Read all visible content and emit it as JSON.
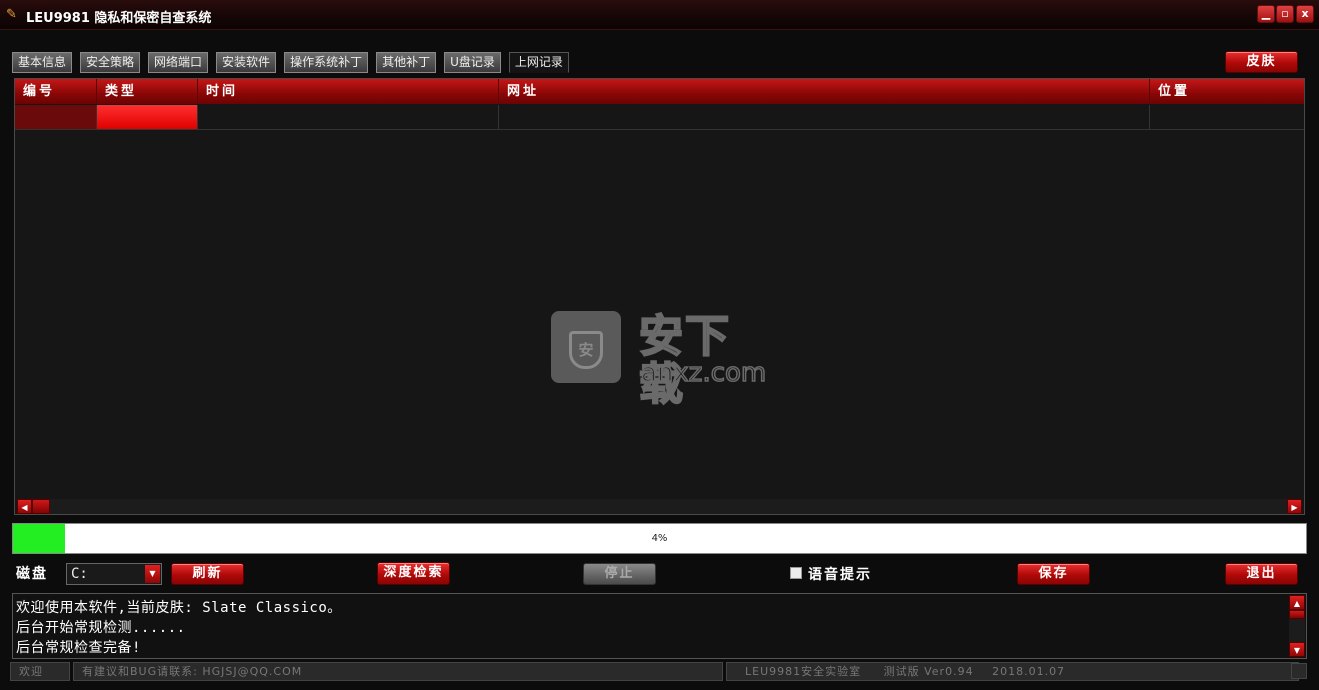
{
  "window": {
    "title": "LEU9981 隐私和保密自查系统",
    "minimize": "▁",
    "maximize": "▫",
    "close": "x"
  },
  "tabs": [
    {
      "label": "基本信息"
    },
    {
      "label": "安全策略"
    },
    {
      "label": "网络端口"
    },
    {
      "label": "安装软件"
    },
    {
      "label": "操作系统补丁"
    },
    {
      "label": "其他补丁"
    },
    {
      "label": "U盘记录"
    },
    {
      "label": "上网记录",
      "active": true
    }
  ],
  "skin_button": "皮肤",
  "table": {
    "columns": [
      "编号",
      "类型",
      "时间",
      "网址",
      "位置"
    ],
    "rows": [
      [
        "",
        "",
        "",
        "",
        ""
      ]
    ]
  },
  "watermark": {
    "cn": "安下载",
    "en": "anxz.com",
    "shield": "安"
  },
  "progress": {
    "value": 0.04,
    "label": "4%",
    "color": "#22ee22"
  },
  "controls": {
    "disk_label": "磁盘",
    "disk_value": "C:",
    "refresh": "刷新",
    "deep_search": "深度检索",
    "stop": "停止",
    "voice_hint": "语音提示",
    "save": "保存",
    "exit": "退出"
  },
  "log": [
    "欢迎使用本软件,当前皮肤: Slate Classico。",
    "后台开始常规检测......",
    "后台常规检查完备!"
  ],
  "status": {
    "welcome": "欢迎",
    "contact": "有建议和BUG请联系: HGJSJ@QQ.COM",
    "lab": "LEU9981安全实验室",
    "version": "测试版 Ver0.94",
    "date": "2018.01.07"
  },
  "colors": {
    "accent": "#c41818",
    "background": "#0c0c0c"
  }
}
